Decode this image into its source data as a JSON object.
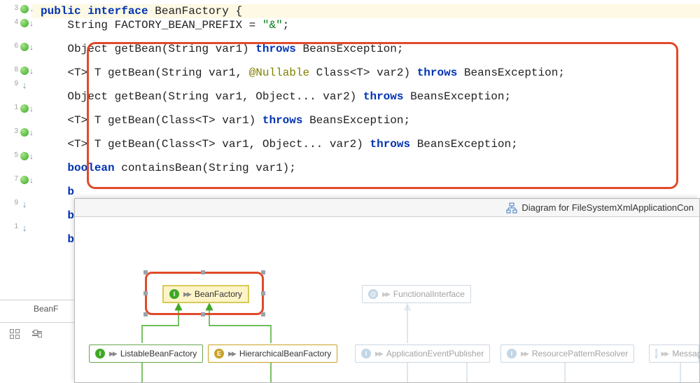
{
  "gutter": [
    {
      "n": "3",
      "icon": "green",
      "arrow": "left"
    },
    {
      "n": "4",
      "icon": "green",
      "arrow": "down"
    },
    {
      "n": "",
      "icon": "",
      "arrow": ""
    },
    {
      "n": "6",
      "icon": "green",
      "arrow": "down"
    },
    {
      "n": "",
      "icon": "",
      "arrow": ""
    },
    {
      "n": "8",
      "icon": "green",
      "arrow": "down"
    },
    {
      "n": "9",
      "icon": "",
      "arrow": "down"
    },
    {
      "n": "",
      "icon": "",
      "arrow": ""
    },
    {
      "n": "1",
      "icon": "green",
      "arrow": "down"
    },
    {
      "n": "",
      "icon": "",
      "arrow": ""
    },
    {
      "n": "3",
      "icon": "green",
      "arrow": "down"
    },
    {
      "n": "",
      "icon": "",
      "arrow": ""
    },
    {
      "n": "5",
      "icon": "green",
      "arrow": "down"
    },
    {
      "n": "",
      "icon": "",
      "arrow": ""
    },
    {
      "n": "7",
      "icon": "green",
      "arrow": "down"
    },
    {
      "n": "",
      "icon": "",
      "arrow": ""
    },
    {
      "n": "9",
      "icon": "",
      "arrow": "down"
    },
    {
      "n": "",
      "icon": "",
      "arrow": ""
    },
    {
      "n": "1",
      "icon": "",
      "arrow": "down"
    }
  ],
  "code": {
    "l1a": "public",
    "l1b": "interface",
    "l1c": " BeanFactory {",
    "l2a": "    String FACTORY_BEAN_PREFIX = ",
    "l2b": "\"&\"",
    "l2c": ";",
    "blank": "",
    "l4a": "    Object getBean(String var1) ",
    "l4b": "throws",
    "l4c": " BeansException;",
    "l6a": "    <T> T getBean(String var1, ",
    "l6b": "@Nullable",
    "l6c": " Class<T> var2) ",
    "l6d": "throws",
    "l6e": " BeansException;",
    "l8a": "    Object getBean(String var1, Object... var2) ",
    "l8b": "throws",
    "l8c": " BeansException;",
    "l10a": "    <T> T getBean(Class<T> var1) ",
    "l10b": "throws",
    "l10c": " BeansException;",
    "l12a": "    <T> T getBean(Class<T> var1, Object... var2) ",
    "l12b": "throws",
    "l12c": " BeansException;",
    "l14a": "    ",
    "l14b": "boolean",
    "l14c": " containsBean(String var1);",
    "l16": "    b",
    "l18": "    b",
    "l20": "    b"
  },
  "tab": {
    "label": "BeanF"
  },
  "diagram": {
    "title": "Diagram for FileSystemXmlApplicationCon",
    "nodes": {
      "beanFactory": "BeanFactory",
      "functionalInterface": "FunctionalInterface",
      "listable": "ListableBeanFactory",
      "hierarchical": "HierarchicalBeanFactory",
      "appEvent": "ApplicationEventPublisher",
      "resource": "ResourcePatternResolver",
      "message": "Messag"
    },
    "tris": "▶▶"
  }
}
